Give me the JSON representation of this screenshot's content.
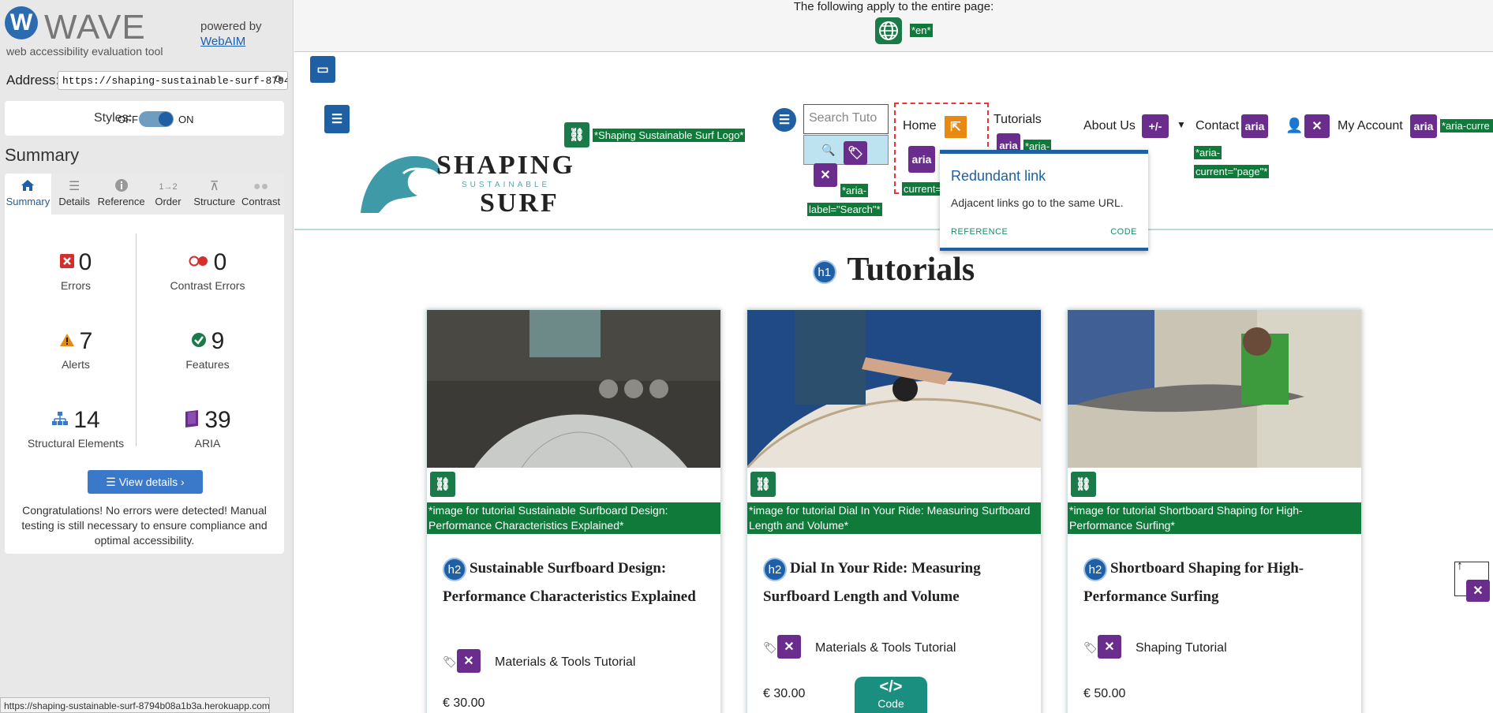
{
  "wave": {
    "title": "WAVE",
    "subtitle": "web accessibility evaluation tool",
    "powered_by": "powered by",
    "webaim": "WebAIM",
    "address_label": "Address:",
    "address_value": "https://shaping-sustainable-surf-8794b08a1b3a.herokuapp.com/",
    "styles_label": "Styles:",
    "styles_off": "OFF",
    "styles_on": "ON",
    "summary_title": "Summary",
    "tabs": [
      {
        "label": "Summary",
        "icon": "home-icon"
      },
      {
        "label": "Details",
        "icon": "list-icon"
      },
      {
        "label": "Reference",
        "icon": "info-icon"
      },
      {
        "label": "Order",
        "icon": "order-icon"
      },
      {
        "label": "Structure",
        "icon": "structure-icon"
      },
      {
        "label": "Contrast",
        "icon": "contrast-icon"
      }
    ],
    "stats": {
      "errors": {
        "value": "0",
        "label": "Errors"
      },
      "contrast": {
        "value": "0",
        "label": "Contrast Errors"
      },
      "alerts": {
        "value": "7",
        "label": "Alerts"
      },
      "features": {
        "value": "9",
        "label": "Features"
      },
      "structural": {
        "value": "14",
        "label": "Structural Elements"
      },
      "aria": {
        "value": "39",
        "label": "ARIA"
      }
    },
    "view_details": "View details ›",
    "congrats": "Congratulations! No errors were detected! Manual testing is still necessary to ensure compliance and optimal accessibility.",
    "status_url": "https://shaping-sustainable-surf-8794b08a1b3a.herokuapp.com"
  },
  "page": {
    "top_note": "The following apply to the entire page:",
    "lang_label": "*en*",
    "logo_alt_label": "*Shaping Sustainable Surf Logo*",
    "brand_line1": "SHAPING",
    "brand_line2": "SUSTAINABLE",
    "brand_line3": "SURF",
    "search_placeholder": "Search Tuto",
    "aria_label_search_1": "*aria-",
    "aria_label_search_2": "label=\"Search\"*",
    "nav": {
      "home": "Home",
      "tutorials": "Tutorials",
      "about": "About Us",
      "contact": "Contact",
      "account": "My Account"
    },
    "aria_word": "aria",
    "plusminus": "+/-",
    "aria_current_1": "*aria-",
    "aria_current_2": "current=\"page\"*",
    "aria_current_short": "*aria-curre",
    "current_fragment": "current=",
    "tooltip": {
      "title": "Redundant link",
      "body": "Adjacent links go to the same URL.",
      "reference": "REFERENCE",
      "code": "CODE"
    },
    "h1": "Tutorials",
    "h1_badge": "h1",
    "h2_badge": "h2",
    "cards": [
      {
        "alt": "*image for tutorial Sustainable Surfboard Design: Performance Characteristics Explained*",
        "title": "Sustainable Surfboard Design: Performance Characteristics Explained",
        "category": "Materials & Tools Tutorial",
        "price": "€ 30.00"
      },
      {
        "alt": "*image for tutorial Dial In Your Ride: Measuring Surfboard Length and Volume*",
        "title": "Dial In Your Ride: Measuring Surfboard Length and Volume",
        "category": "Materials & Tools Tutorial",
        "price": "€ 30.00"
      },
      {
        "alt": "*image for tutorial Shortboard Shaping for High-Performance Surfing*",
        "title": "Shortboard Shaping for High-Performance Surfing",
        "category": "Shaping Tutorial",
        "price": "€ 50.00"
      }
    ],
    "code_button": "Code",
    "code_glyph": "</>"
  },
  "colors": {
    "wave_blue": "#1f5fa3",
    "feature_green": "#1b7a4a",
    "aria_purple": "#6a2d8e",
    "alert_orange": "#e88a12",
    "error_red": "#d32f2f"
  }
}
